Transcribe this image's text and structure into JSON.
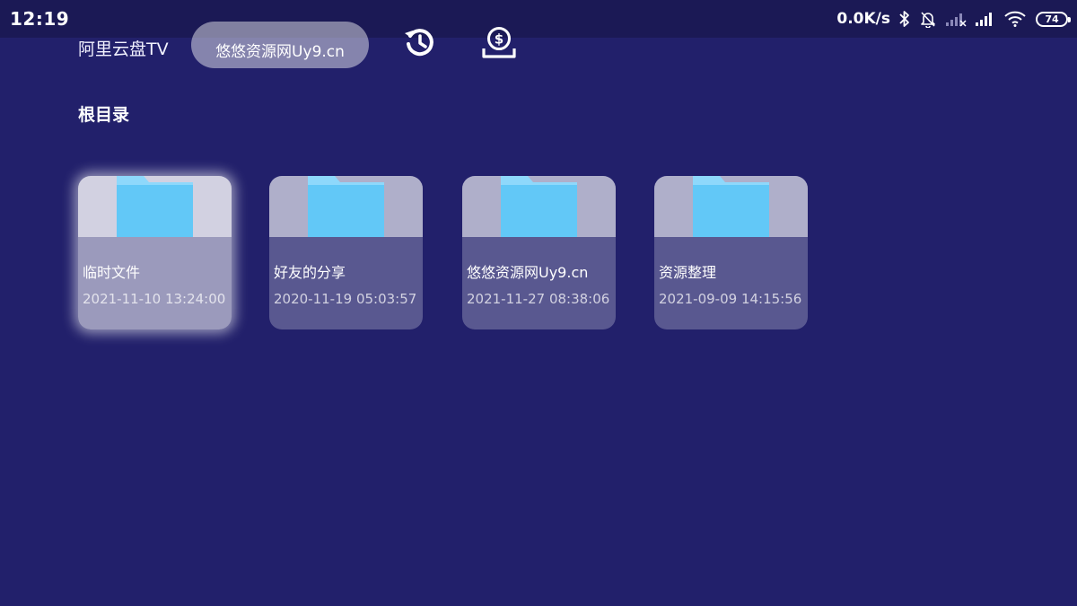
{
  "status_bar": {
    "time": "12:19",
    "net_speed": "0.0K/s",
    "battery_level": "74",
    "icons": [
      "bluetooth-icon",
      "bell-muted-icon",
      "signal-weak-icon",
      "signal-icon",
      "wifi-icon",
      "battery-icon"
    ]
  },
  "header": {
    "app_title": "阿里云盘TV",
    "search_text": "悠悠资源网Uy9.cn",
    "history_icon": "history-icon",
    "sync_icon": "dollar-download-icon"
  },
  "section": {
    "title": "根目录"
  },
  "folders": [
    {
      "name": "临时文件",
      "date": "2021-11-10 13:24:00",
      "focused": true
    },
    {
      "name": "好友的分享",
      "date": "2020-11-19 05:03:57",
      "focused": false
    },
    {
      "name": "悠悠资源网Uy9.cn",
      "date": "2021-11-27 08:38:06",
      "focused": false
    },
    {
      "name": "资源整理",
      "date": "2021-09-09 14:15:56",
      "focused": false
    }
  ],
  "colors": {
    "background": "#22206b",
    "status_bar": "#1b1955",
    "folder": "#62c8f7",
    "folder_tab": "#8ed8fb"
  }
}
